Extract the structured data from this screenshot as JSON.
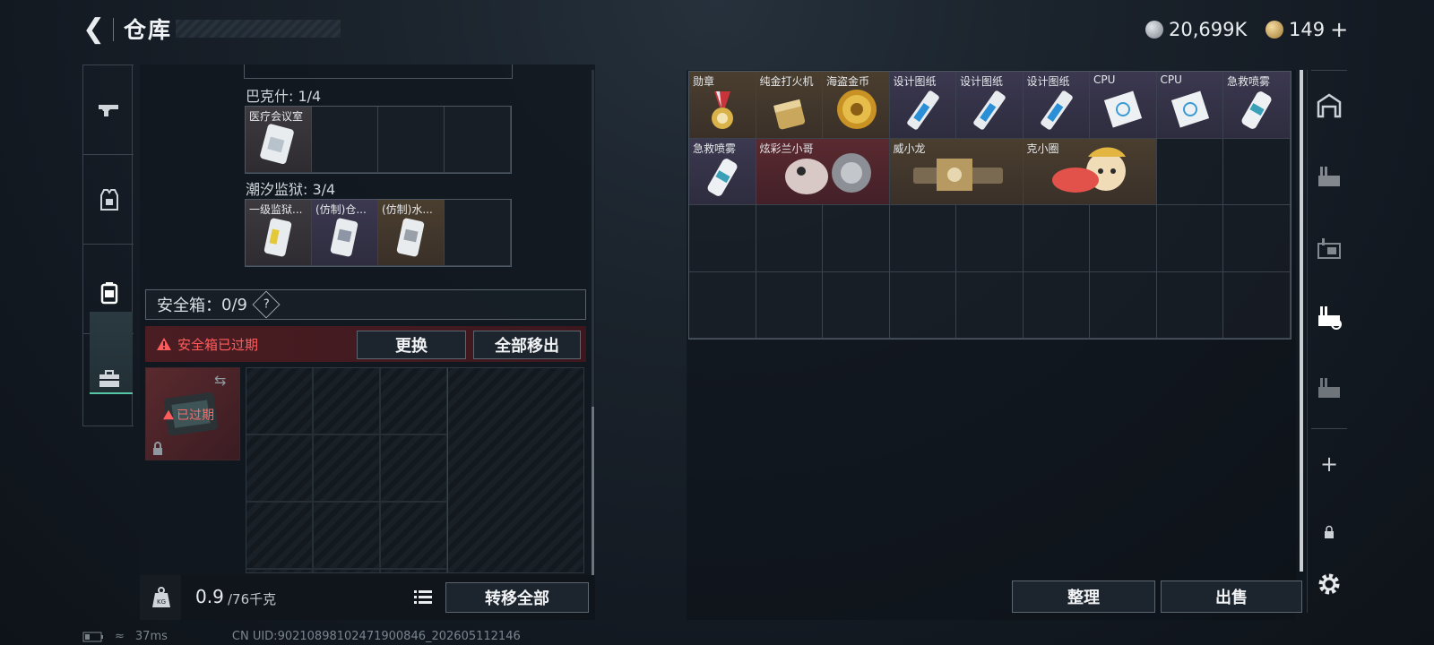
{
  "header": {
    "title": "仓库",
    "currency1": "20,699K",
    "currency2": "149",
    "add_symbol": "+"
  },
  "left": {
    "bakeshi_label": "巴克什: 1/4",
    "bakeshi_items": [
      {
        "label": "医疗会议室"
      },
      {
        "label": ""
      },
      {
        "label": ""
      },
      {
        "label": ""
      }
    ],
    "chaoxi_label": "潮汐监狱: 3/4",
    "chaoxi_items": [
      {
        "label": "一级监狱..."
      },
      {
        "label": "(仿制)仓..."
      },
      {
        "label": "(仿制)水..."
      },
      {
        "label": ""
      }
    ],
    "safebox_label": "安全箱",
    "safebox_count": "0/9",
    "help_mark": "?",
    "expired_msg": "安全箱已过期",
    "replace_btn": "更换",
    "remove_all_btn": "全部移出",
    "case_expired": "已过期",
    "weight_value": "0.9",
    "weight_max": "/76千克",
    "transfer_all_btn": "转移全部"
  },
  "right": {
    "items": [
      {
        "label": "勋章"
      },
      {
        "label": "纯金打火机"
      },
      {
        "label": "海盗金币"
      },
      {
        "label": "设计图纸"
      },
      {
        "label": "设计图纸"
      },
      {
        "label": "设计图纸"
      },
      {
        "label": "CPU"
      },
      {
        "label": "CPU"
      },
      {
        "label": "急救喷雾"
      },
      {
        "label": "急救喷雾"
      },
      {
        "label": "炫彩兰小哥"
      },
      {
        "label": "威小龙"
      },
      {
        "label": "克小圈"
      }
    ],
    "sort_btn": "整理",
    "sell_btn": "出售"
  },
  "status": {
    "ping": "37ms",
    "uid": "CN UID:90210898102471900846_202605112146"
  },
  "colors": {
    "accent": "#56c6a6",
    "warning": "#ff5d5d"
  }
}
